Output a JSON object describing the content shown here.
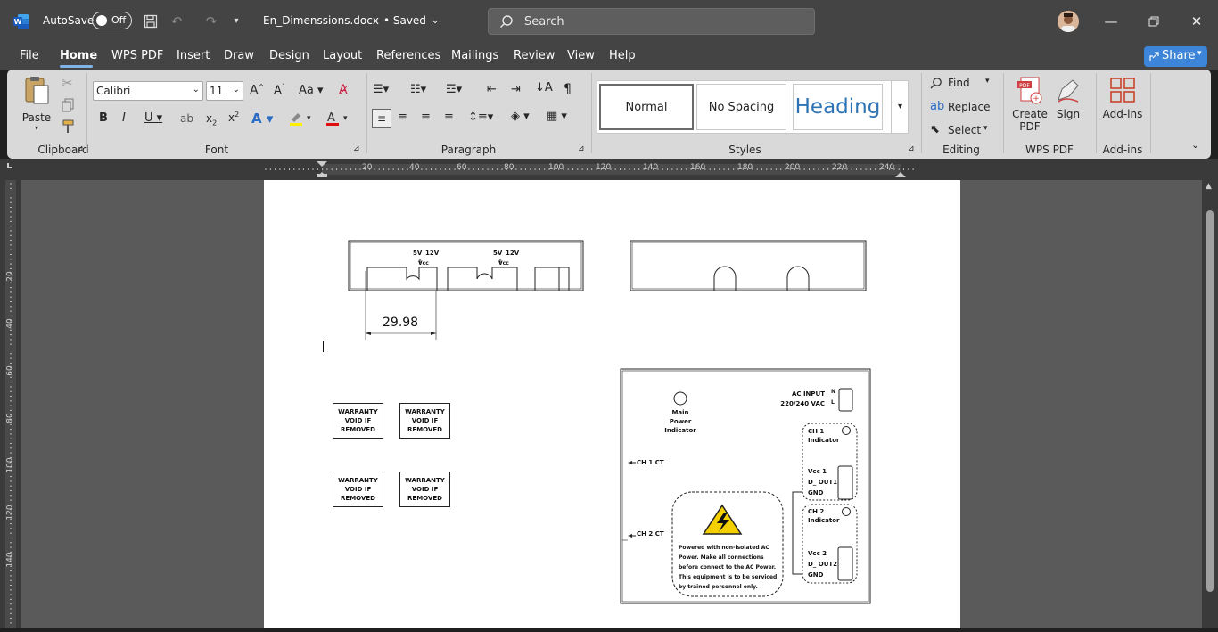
{
  "title": {
    "autosave_label": "AutoSave",
    "autosave_state": "Off",
    "document_name": "En_Dimenssions.docx",
    "saved_status": "• Saved",
    "search_placeholder": "Search"
  },
  "menu": {
    "items": [
      "File",
      "Home",
      "WPS PDF",
      "Insert",
      "Draw",
      "Design",
      "Layout",
      "References",
      "Mailings",
      "Review",
      "View",
      "Help"
    ],
    "share_label": "Share"
  },
  "ribbon": {
    "clipboard": {
      "paste_label": "Paste",
      "group_label": "Clipboard"
    },
    "font": {
      "font_name": "Calibri",
      "font_size": "11",
      "group_label": "Font"
    },
    "paragraph": {
      "group_label": "Paragraph"
    },
    "styles": {
      "normal": "Normal",
      "no_spacing": "No Spacing",
      "heading": "Heading",
      "group_label": "Styles"
    },
    "editing": {
      "find": "Find",
      "replace": "Replace",
      "select": "Select",
      "group_label": "Editing"
    },
    "wps": {
      "create_pdf": "Create PDF",
      "sign": "Sign",
      "group_label": "WPS PDF"
    },
    "addins": {
      "label": "Add-ins",
      "group_label": "Add-ins"
    }
  },
  "ruler": {
    "h_ticks": [
      "20",
      "40",
      "60",
      "80",
      "100",
      "120",
      "140",
      "160",
      "180",
      "200",
      "220",
      "240"
    ],
    "v_ticks": [
      "20",
      "40",
      "60",
      "80",
      "100",
      "120",
      "140"
    ]
  },
  "drawing": {
    "dimension": "29.98",
    "supply_labels": [
      "5V",
      "12V",
      "Vcc"
    ],
    "warranty": [
      "WARRANTY",
      "VOID IF",
      "REMOVED"
    ],
    "main_power": [
      "Main Power",
      "Indicator"
    ],
    "ac_input": [
      "AC INPUT",
      "220/240 VAC"
    ],
    "ac_pins": [
      "N",
      "L"
    ],
    "ch1": [
      "CH 1",
      "Indicator"
    ],
    "ch1_pins": [
      "Vcc 1",
      "D_ OUT1",
      "GND"
    ],
    "ch2": [
      "CH 2",
      "Indicator"
    ],
    "ch2_pins": [
      "Vcc 2",
      "D_ OUT2",
      "GND"
    ],
    "ch1_ct": "CH 1 CT",
    "ch2_ct": "CH 2 CT",
    "warning": [
      "Powered with non-isolated AC",
      "Power. Make all connections",
      "before connect to the AC Power.",
      "This equipment is to be serviced",
      "by trained personnel only."
    ]
  },
  "colors": {
    "accent": "#3d85d8",
    "titlebar": "#444444",
    "ribbon": "#d9d9d9"
  }
}
